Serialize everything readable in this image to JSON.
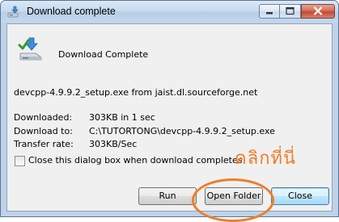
{
  "window": {
    "title": "Download complete"
  },
  "dialog": {
    "header": "Download Complete",
    "source": "devcpp-4.9.9.2_setup.exe from jaist.dl.sourceforge.net",
    "rows": [
      {
        "label": "Downloaded:",
        "value": "303KB in 1 sec"
      },
      {
        "label": "Download to:",
        "value": "C:\\TUTORTONG\\devcpp-4.9.9.2_setup.exe"
      },
      {
        "label": "Transfer rate:",
        "value": "303KB/Sec"
      }
    ],
    "checkbox_label": "Close this dialog box when download completes",
    "checkbox_checked": false
  },
  "annotation": {
    "text": "คลิกที่นี่",
    "color": "#ee7e2c"
  },
  "buttons": {
    "run": "Run",
    "open_folder": "Open Folder",
    "close": "Close"
  },
  "icons": {
    "app": "download-window-icon",
    "header": "download-complete-icon",
    "min": "minimize-icon",
    "max": "maximize-icon",
    "close": "close-icon"
  }
}
